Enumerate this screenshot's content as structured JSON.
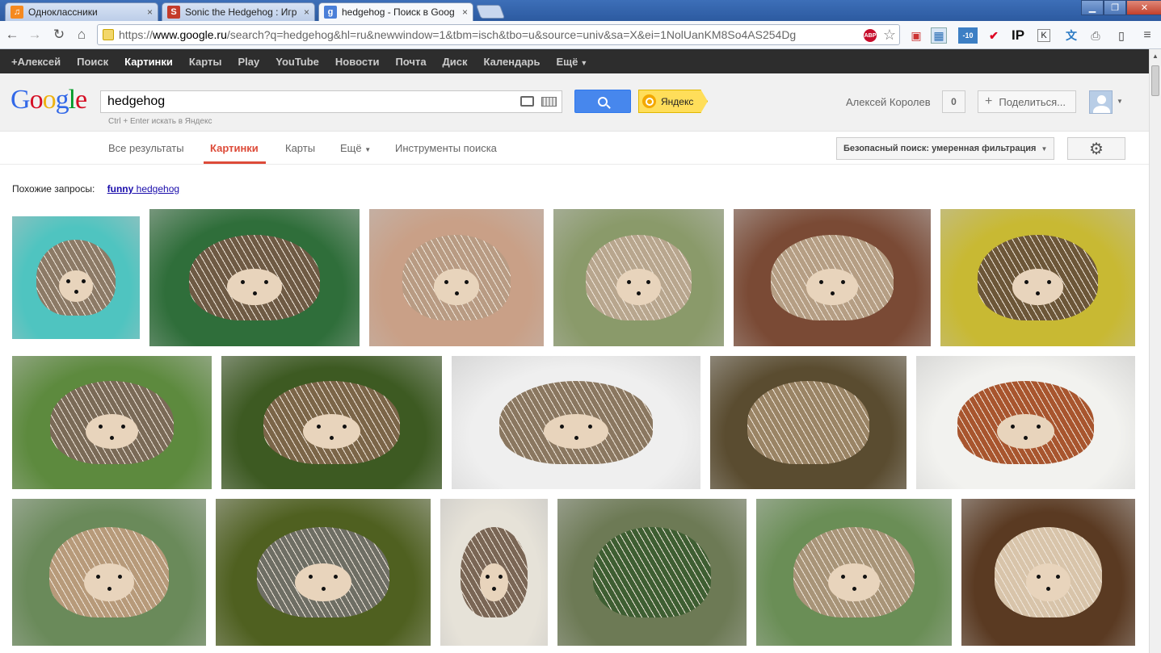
{
  "browser": {
    "tabs": [
      {
        "title": "Одноклассники",
        "favicon_color": "#f5891f",
        "active": false
      },
      {
        "title": "Sonic the Hedgehog : Игр",
        "favicon_color": "#c43b2a",
        "active": false
      },
      {
        "title": "hedgehog - Поиск в Goog",
        "favicon_color": "#4a7fd8",
        "active": true
      }
    ],
    "tab_close": "×",
    "url_prefix": "https://",
    "url_host": "www.google.ru",
    "url_rest": "/search?q=hedgehog&hl=ru&newwindow=1&tbm=isch&tbo=u&source=univ&sa=X&ei=1NolUanKM8So4AS254Dg",
    "abp_label": "ABP",
    "ext_ip_label": "IP",
    "ext_k_label": "K",
    "ext_weather_label": "-10"
  },
  "gbar": {
    "items": [
      "+Алексей",
      "Поиск",
      "Картинки",
      "Карты",
      "Play",
      "YouTube",
      "Новости",
      "Почта",
      "Диск",
      "Календарь",
      "Ещё"
    ],
    "selected": "Картинки"
  },
  "header": {
    "logo_letters": [
      {
        "ch": "G",
        "color": "#3369e8"
      },
      {
        "ch": "o",
        "color": "#d50f25"
      },
      {
        "ch": "o",
        "color": "#eeb211"
      },
      {
        "ch": "g",
        "color": "#3369e8"
      },
      {
        "ch": "l",
        "color": "#009925"
      },
      {
        "ch": "e",
        "color": "#d50f25"
      }
    ],
    "query": "hedgehog",
    "hint": "Ctrl + Enter искать в Яндекс",
    "yandex_label": "Яндекс",
    "user_name": "Алексей Королев",
    "notif_count": "0",
    "share_label": "Поделиться..."
  },
  "nav": {
    "tabs": [
      "Все результаты",
      "Картинки",
      "Карты",
      "Ещё",
      "Инструменты поиска"
    ],
    "selected": "Картинки",
    "safe_search": "Безопасный поиск: умеренная фильтрация"
  },
  "related": {
    "label": "Похожие запросы:",
    "link_bold": "funny",
    "link_rest": "hedgehog"
  },
  "images": [
    {
      "bg": "#4fc4c0",
      "body": "#8c7a66",
      "face": true
    },
    {
      "bg": "#2f6e3a",
      "body": "#6e5a44",
      "face": true
    },
    {
      "bg": "#c9a087",
      "body": "#b89b83",
      "face": true
    },
    {
      "bg": "#8a9a6a",
      "body": "#b8a68e",
      "face": true
    },
    {
      "bg": "#7a4a35",
      "body": "#b59e84",
      "face": true
    },
    {
      "bg": "#c8b933",
      "body": "#6c5638",
      "face": true
    },
    {
      "bg": "#5d8a3e",
      "body": "#7a6a57",
      "face": true
    },
    {
      "bg": "#3d5a22",
      "body": "#7b6548",
      "face": true
    },
    {
      "bg": "#efefef",
      "body": "#8a7760",
      "face": true
    },
    {
      "bg": "#5a4c30",
      "body": "#9a8465",
      "face": false
    },
    {
      "bg": "#f2f2ef",
      "body": "#a8552e",
      "face": true
    },
    {
      "bg": "#6a8a5a",
      "body": "#b79a7a",
      "face": true
    },
    {
      "bg": "#4f6020",
      "body": "#6e6e64",
      "face": true
    },
    {
      "bg": "#e6e2d8",
      "body": "#7a6655",
      "face": true
    },
    {
      "bg": "#6d7a55",
      "body": "#3e5e32",
      "face": false
    },
    {
      "bg": "#6a8e56",
      "body": "#a89478",
      "face": true
    },
    {
      "bg": "#5a3a22",
      "body": "#d8c4aa",
      "face": true
    }
  ]
}
